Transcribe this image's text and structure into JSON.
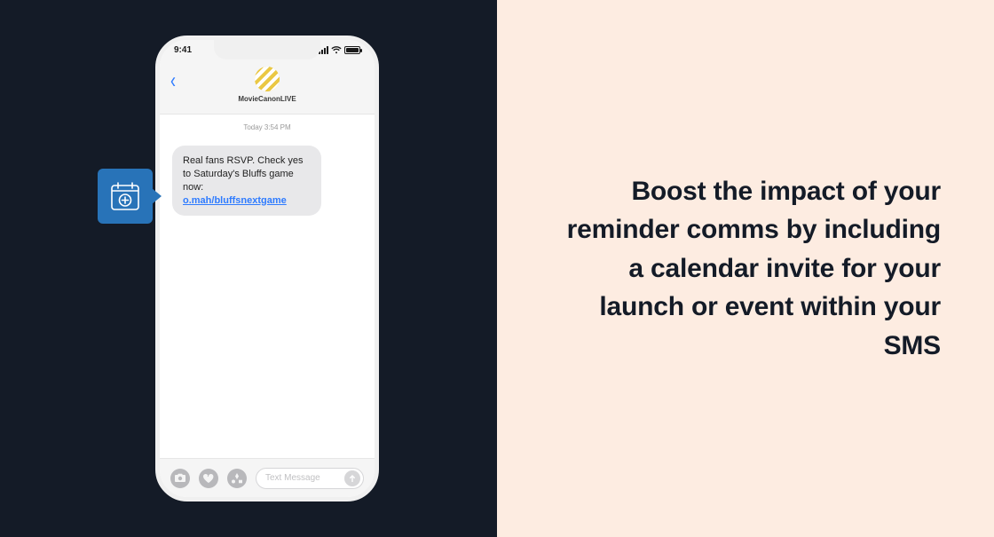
{
  "statusbar": {
    "time": "9:41"
  },
  "chat": {
    "contact_name": "MovieCanonLIVE",
    "day_label": "Today 3:54 PM",
    "message_text": "Real fans RSVP. Check yes to Saturday's Bluffs game now:",
    "message_link_text": "o.mah/bluffsnextgame"
  },
  "compose": {
    "placeholder": "Text Message"
  },
  "callout": {
    "icon": "calendar-add-icon"
  },
  "headline": "Boost the impact of your reminder comms by including a calendar invite for your launch or event within your SMS"
}
